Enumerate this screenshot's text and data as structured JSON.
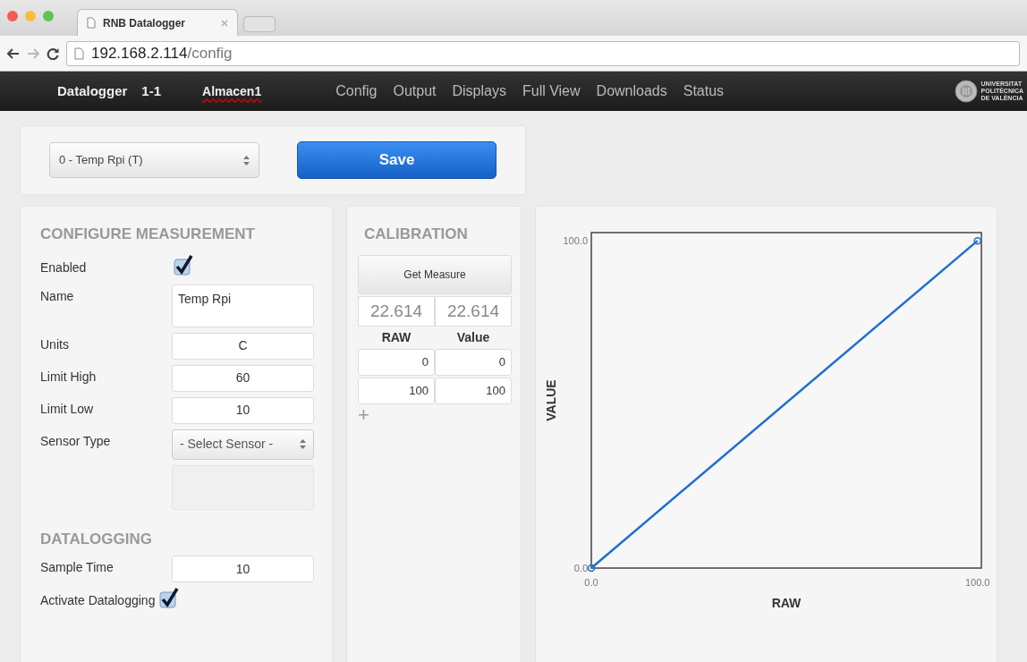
{
  "browser": {
    "tab_title": "RNB Datalogger",
    "url_host": "192.168.2.114",
    "url_path": "/config"
  },
  "navbar": {
    "brand": "Datalogger",
    "id": "1-1",
    "location": "Almacen1",
    "links": [
      {
        "label": "Config",
        "selected": false
      },
      {
        "label": "Output",
        "selected": false
      },
      {
        "label": "Displays",
        "selected": false
      },
      {
        "label": "Full View",
        "selected": false
      },
      {
        "label": "Downloads",
        "selected": false
      },
      {
        "label": "Status",
        "selected": false
      }
    ],
    "logo_text": [
      "UNIVERSITAT",
      "POLITÈCNICA",
      "DE VALÈNCIA"
    ]
  },
  "toolbar": {
    "measurement_select": "0 - Temp Rpi (T)",
    "save_button": "Save"
  },
  "configure": {
    "title": "CONFIGURE MEASUREMENT",
    "fields": [
      {
        "kind": "checkbox",
        "label": "Enabled",
        "checked": true
      },
      {
        "kind": "textarea",
        "label": "Name",
        "value": "Temp Rpi"
      },
      {
        "kind": "text",
        "label": "Units",
        "value": "C"
      },
      {
        "kind": "text",
        "label": "Limit High",
        "value": "60"
      },
      {
        "kind": "text",
        "label": "Limit Low",
        "value": "10"
      },
      {
        "kind": "select",
        "label": "Sensor Type",
        "value": "- Select Sensor -"
      },
      {
        "kind": "empty"
      }
    ]
  },
  "datalogging": {
    "title": "DATALOGGING",
    "fields": [
      {
        "kind": "text",
        "label": "Sample Time",
        "value": "10"
      },
      {
        "kind": "checkbox",
        "label": "Activate Datalogging",
        "checked": true
      }
    ]
  },
  "calibration": {
    "title": "CALIBRATION",
    "get_button": "Get Measure",
    "measured": [
      "22.614",
      "22.614"
    ],
    "columns": [
      "RAW",
      "Value"
    ],
    "rows": [
      [
        "0",
        "0"
      ],
      [
        "100",
        "100"
      ]
    ],
    "add": "+"
  },
  "chart": {
    "chart_data": {
      "type": "line",
      "xlabel": "RAW",
      "ylabel": "VALUE",
      "x": [
        0,
        100
      ],
      "series": [
        {
          "color": "#1f6fce",
          "marker": "circle",
          "values": [
            0,
            100
          ]
        }
      ],
      "xlim": [
        0,
        101
      ],
      "ylim": [
        0,
        102.5
      ],
      "xticks": [
        {
          "value": 0,
          "label": "0.0"
        },
        {
          "value": 100,
          "label": "100.0"
        }
      ],
      "yticks": [
        {
          "value": 0,
          "label": "0.0"
        },
        {
          "value": 100,
          "label": "100.0"
        }
      ]
    }
  }
}
